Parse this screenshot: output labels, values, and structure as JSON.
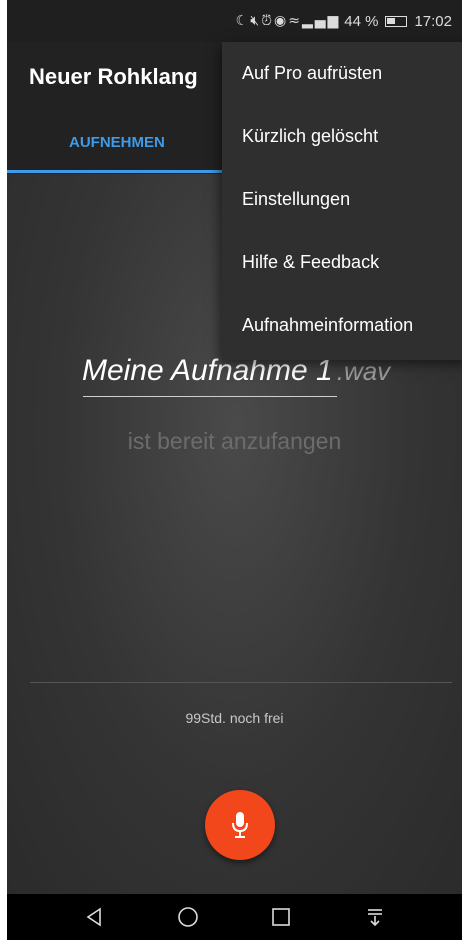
{
  "status_bar": {
    "icons": [
      "moon-icon",
      "mute-icon",
      "alarm-icon",
      "eye-comfort-icon",
      "wifi-icon",
      "signal-icon"
    ],
    "battery_text": "44 %",
    "time": "17:02"
  },
  "app_bar": {
    "title": "Neuer Rohklang",
    "tab_record": "AUFNEHMEN"
  },
  "main": {
    "filename": "Meine Aufnahme 1",
    "extension": ".wav",
    "status": "ist bereit anzufangen",
    "free_space": "99Std. noch frei"
  },
  "overflow_menu": {
    "items": [
      "Auf Pro aufrüsten",
      "Kürzlich gelöscht",
      "Einstellungen",
      "Hilfe & Feedback",
      "Aufnahmeinformation"
    ]
  },
  "colors": {
    "accent": "#3d9be9",
    "record_button": "#f2461b",
    "background": "#2e2e2e"
  },
  "nav_bar": {
    "icons": [
      "back-icon",
      "home-icon",
      "recents-icon",
      "notification-pull-icon"
    ]
  }
}
